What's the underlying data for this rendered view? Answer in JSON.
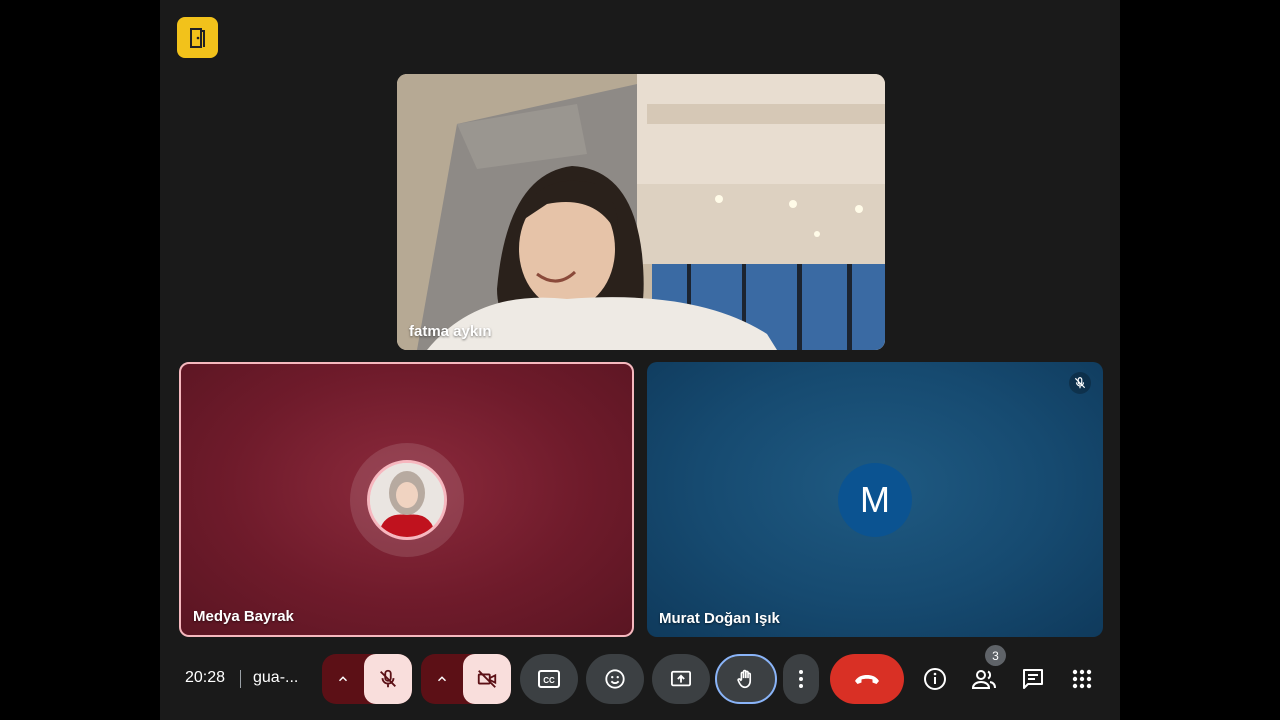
{
  "app": {
    "logo_icon": "door-exit-icon",
    "accent": "#f2c21b"
  },
  "participants": [
    {
      "name": "fatma aykın",
      "type": "video"
    },
    {
      "name": "Medya Bayrak",
      "type": "avatar-photo",
      "speaking": true,
      "tile_color": "#6f1b2b"
    },
    {
      "name": "Murat Doğan Işık",
      "type": "avatar-letter",
      "initial": "M",
      "muted": true,
      "tile_color": "#164a70"
    }
  ],
  "toolbar": {
    "time": "20:28",
    "meeting_code": "gua-...",
    "people_count": "3",
    "end_call_color": "#d93025",
    "icons": {
      "mic": "mic-off-icon",
      "camera": "camera-off-icon",
      "captions": "captions-icon",
      "emoji": "emoji-icon",
      "present": "present-screen-icon",
      "raise_hand": "raise-hand-icon",
      "more": "more-options-icon",
      "end_call": "end-call-icon",
      "info": "info-icon",
      "people": "people-icon",
      "chat": "chat-icon",
      "activities": "activities-icon"
    }
  }
}
